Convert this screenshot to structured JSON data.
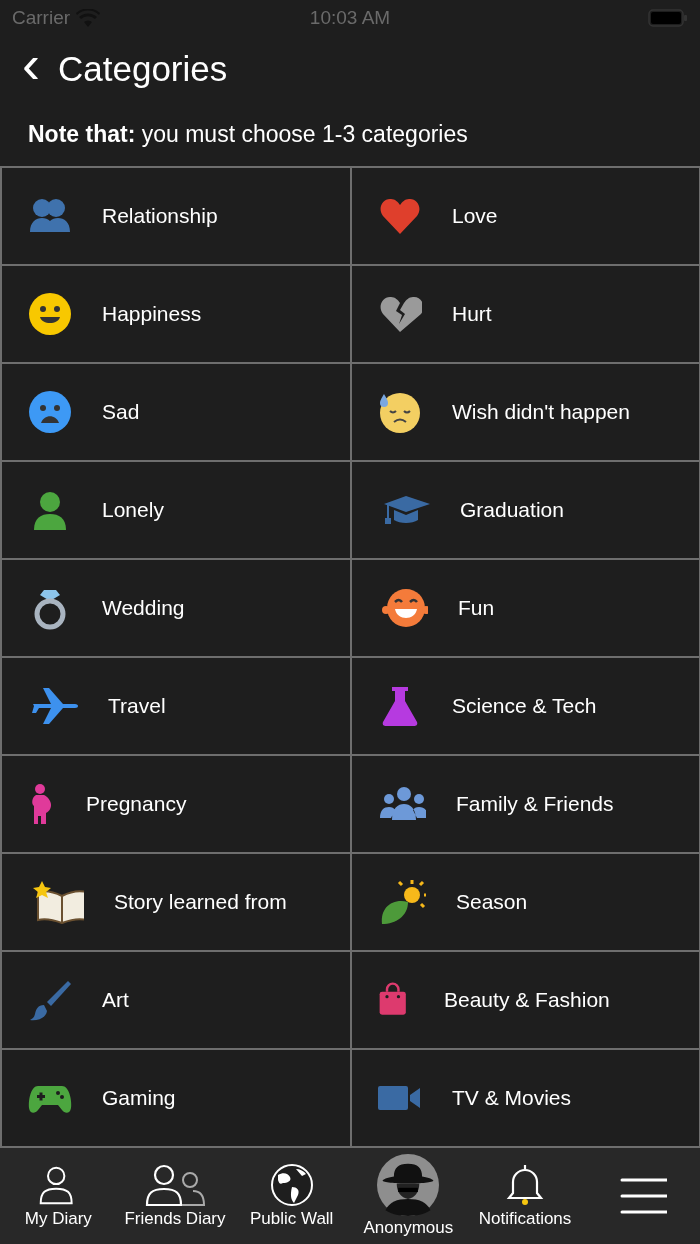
{
  "status_bar": {
    "carrier": "Carrier",
    "time": "10:03 AM"
  },
  "header": {
    "back": "‹",
    "title": "Categories"
  },
  "note": "**Note that:** you must choose 1-3 categories",
  "categories": [
    {
      "label": "Relationship",
      "kind": "couple"
    },
    {
      "label": "Love",
      "kind": "heart"
    },
    {
      "label": "Happiness",
      "kind": "smile"
    },
    {
      "label": "Hurt",
      "kind": "broken"
    },
    {
      "label": "Sad",
      "kind": "sad"
    },
    {
      "label": "Wish didn't happen",
      "kind": "sweat"
    },
    {
      "label": "Lonely",
      "kind": "person"
    },
    {
      "label": "Graduation",
      "kind": "cap"
    },
    {
      "label": "Wedding",
      "kind": "ring"
    },
    {
      "label": "Fun",
      "kind": "laugh"
    },
    {
      "label": "Travel",
      "kind": "plane"
    },
    {
      "label": "Science & Tech",
      "kind": "flask"
    },
    {
      "label": "Pregnancy",
      "kind": "pregnant"
    },
    {
      "label": "Family & Friends",
      "kind": "group"
    },
    {
      "label": "Story learned from",
      "kind": "book"
    },
    {
      "label": "Season",
      "kind": "leaf"
    },
    {
      "label": "Art",
      "kind": "brush"
    },
    {
      "label": "Beauty & Fashion",
      "kind": "bag"
    },
    {
      "label": "Gaming",
      "kind": "gamepad"
    },
    {
      "label": "TV & Movies",
      "kind": "camera"
    }
  ],
  "tabs": [
    {
      "label": "My Diary",
      "kind": "user"
    },
    {
      "label": "Friends Diary",
      "kind": "users"
    },
    {
      "label": "Public Wall",
      "kind": "globe"
    },
    {
      "label": "Anonymous",
      "kind": "spy"
    },
    {
      "label": "Notifications",
      "kind": "bell"
    },
    {
      "kind": "menu"
    }
  ]
}
